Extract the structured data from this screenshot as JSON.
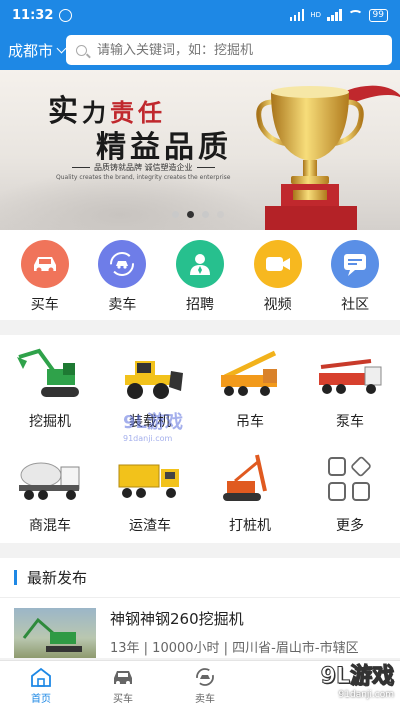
{
  "status_bar": {
    "time": "11:32",
    "network": "HD",
    "battery": "99"
  },
  "top_bar": {
    "city": "成都市",
    "search_placeholder": "请输入关键词，如：挖掘机"
  },
  "banner": {
    "line1_a": "实",
    "line1_b": "力",
    "line1_c": "责任",
    "line2": "精益品质",
    "tagline": "品质铸就品牌  诚信塑造企业",
    "tagline_en": "Quality creates the brand, integrity creates the enterprise",
    "slide_count": 4,
    "active_slide": 2
  },
  "quick_actions": [
    {
      "label": "买车",
      "icon": "car-icon",
      "color": "#f0745a"
    },
    {
      "label": "卖车",
      "icon": "sell-car-icon",
      "color": "#6e7de8"
    },
    {
      "label": "招聘",
      "icon": "person-icon",
      "color": "#27c08e"
    },
    {
      "label": "视频",
      "icon": "video-icon",
      "color": "#f7b81f"
    },
    {
      "label": "社区",
      "icon": "chat-icon",
      "color": "#5a8fe6"
    }
  ],
  "categories": [
    {
      "label": "挖掘机",
      "icon": "excavator-icon"
    },
    {
      "label": "装载机",
      "icon": "loader-icon"
    },
    {
      "label": "吊车",
      "icon": "crane-icon"
    },
    {
      "label": "泵车",
      "icon": "pump-truck-icon"
    },
    {
      "label": "商混车",
      "icon": "mixer-truck-icon"
    },
    {
      "label": "运渣车",
      "icon": "dump-truck-icon"
    },
    {
      "label": "打桩机",
      "icon": "pile-driver-icon"
    },
    {
      "label": "更多",
      "icon": "more-grid-icon"
    }
  ],
  "latest": {
    "heading": "最新发布",
    "items": [
      {
        "title": "神钢神钢260挖掘机",
        "meta": "13年 | 10000小时 | 四川省-眉山市-市辖区"
      }
    ]
  },
  "tab_bar": [
    {
      "label": "首页",
      "icon": "home-icon",
      "active": true
    },
    {
      "label": "买车",
      "icon": "car-icon",
      "active": false
    },
    {
      "label": "卖车",
      "icon": "sell-car-icon",
      "active": false
    }
  ],
  "watermarks": {
    "corner_title": "9L游戏",
    "corner_url": "91danji.com",
    "center_title": "9L游戏",
    "center_url": "91danji.com"
  },
  "colors": {
    "brand_blue": "#1e88e5",
    "accent_red": "#c0282d"
  }
}
